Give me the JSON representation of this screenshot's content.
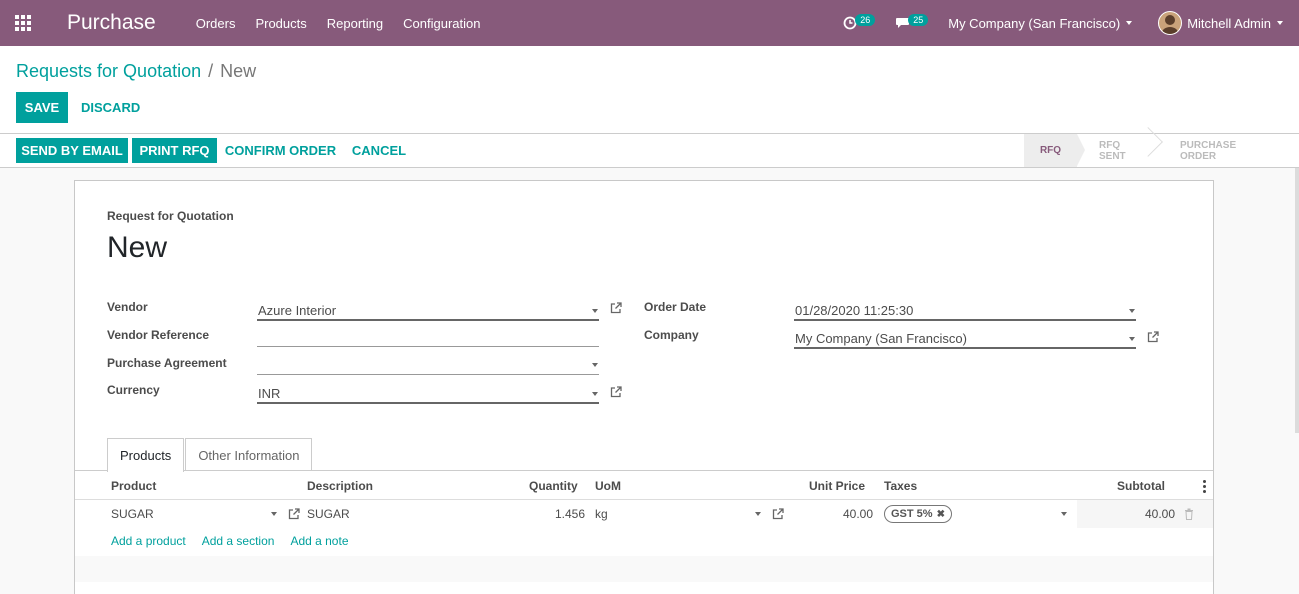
{
  "navbar": {
    "app_name": "Purchase",
    "menu": [
      "Orders",
      "Products",
      "Reporting",
      "Configuration"
    ],
    "activity_count": "26",
    "message_count": "25",
    "company": "My Company (San Francisco)",
    "user": "Mitchell Admin",
    "bg_color": "#875a7b"
  },
  "breadcrumb": {
    "parent": "Requests for Quotation",
    "separator": "/",
    "current": "New"
  },
  "buttons": {
    "save": "SAVE",
    "discard": "DISCARD",
    "send_by_email": "SEND BY EMAIL",
    "print_rfq": "PRINT RFQ",
    "confirm_order": "CONFIRM ORDER",
    "cancel": "CANCEL"
  },
  "stages": [
    "RFQ",
    "RFQ SENT",
    "PURCHASE ORDER"
  ],
  "form": {
    "title_label": "Request for Quotation",
    "record_name": "New",
    "fields": {
      "vendor_label": "Vendor",
      "vendor_value": "Azure Interior",
      "vendor_reference_label": "Vendor Reference",
      "vendor_reference_value": "",
      "purchase_agreement_label": "Purchase Agreement",
      "purchase_agreement_value": "",
      "currency_label": "Currency",
      "currency_value": "INR",
      "order_date_label": "Order Date",
      "order_date_value": "01/28/2020 11:25:30",
      "company_label": "Company",
      "company_value": "My Company (San Francisco)"
    }
  },
  "tabs": [
    "Products",
    "Other Information"
  ],
  "table": {
    "headers": {
      "product": "Product",
      "description": "Description",
      "quantity": "Quantity",
      "uom": "UoM",
      "unit_price": "Unit Price",
      "taxes": "Taxes",
      "subtotal": "Subtotal"
    },
    "row": {
      "product": "SUGAR",
      "description": "SUGAR",
      "quantity": "1.456",
      "uom": "kg",
      "unit_price": "40.00",
      "tax": "GST 5%",
      "subtotal": "40.00"
    },
    "add_links": [
      "Add a product",
      "Add a section",
      "Add a note"
    ]
  },
  "accent_color": "#00a09d"
}
